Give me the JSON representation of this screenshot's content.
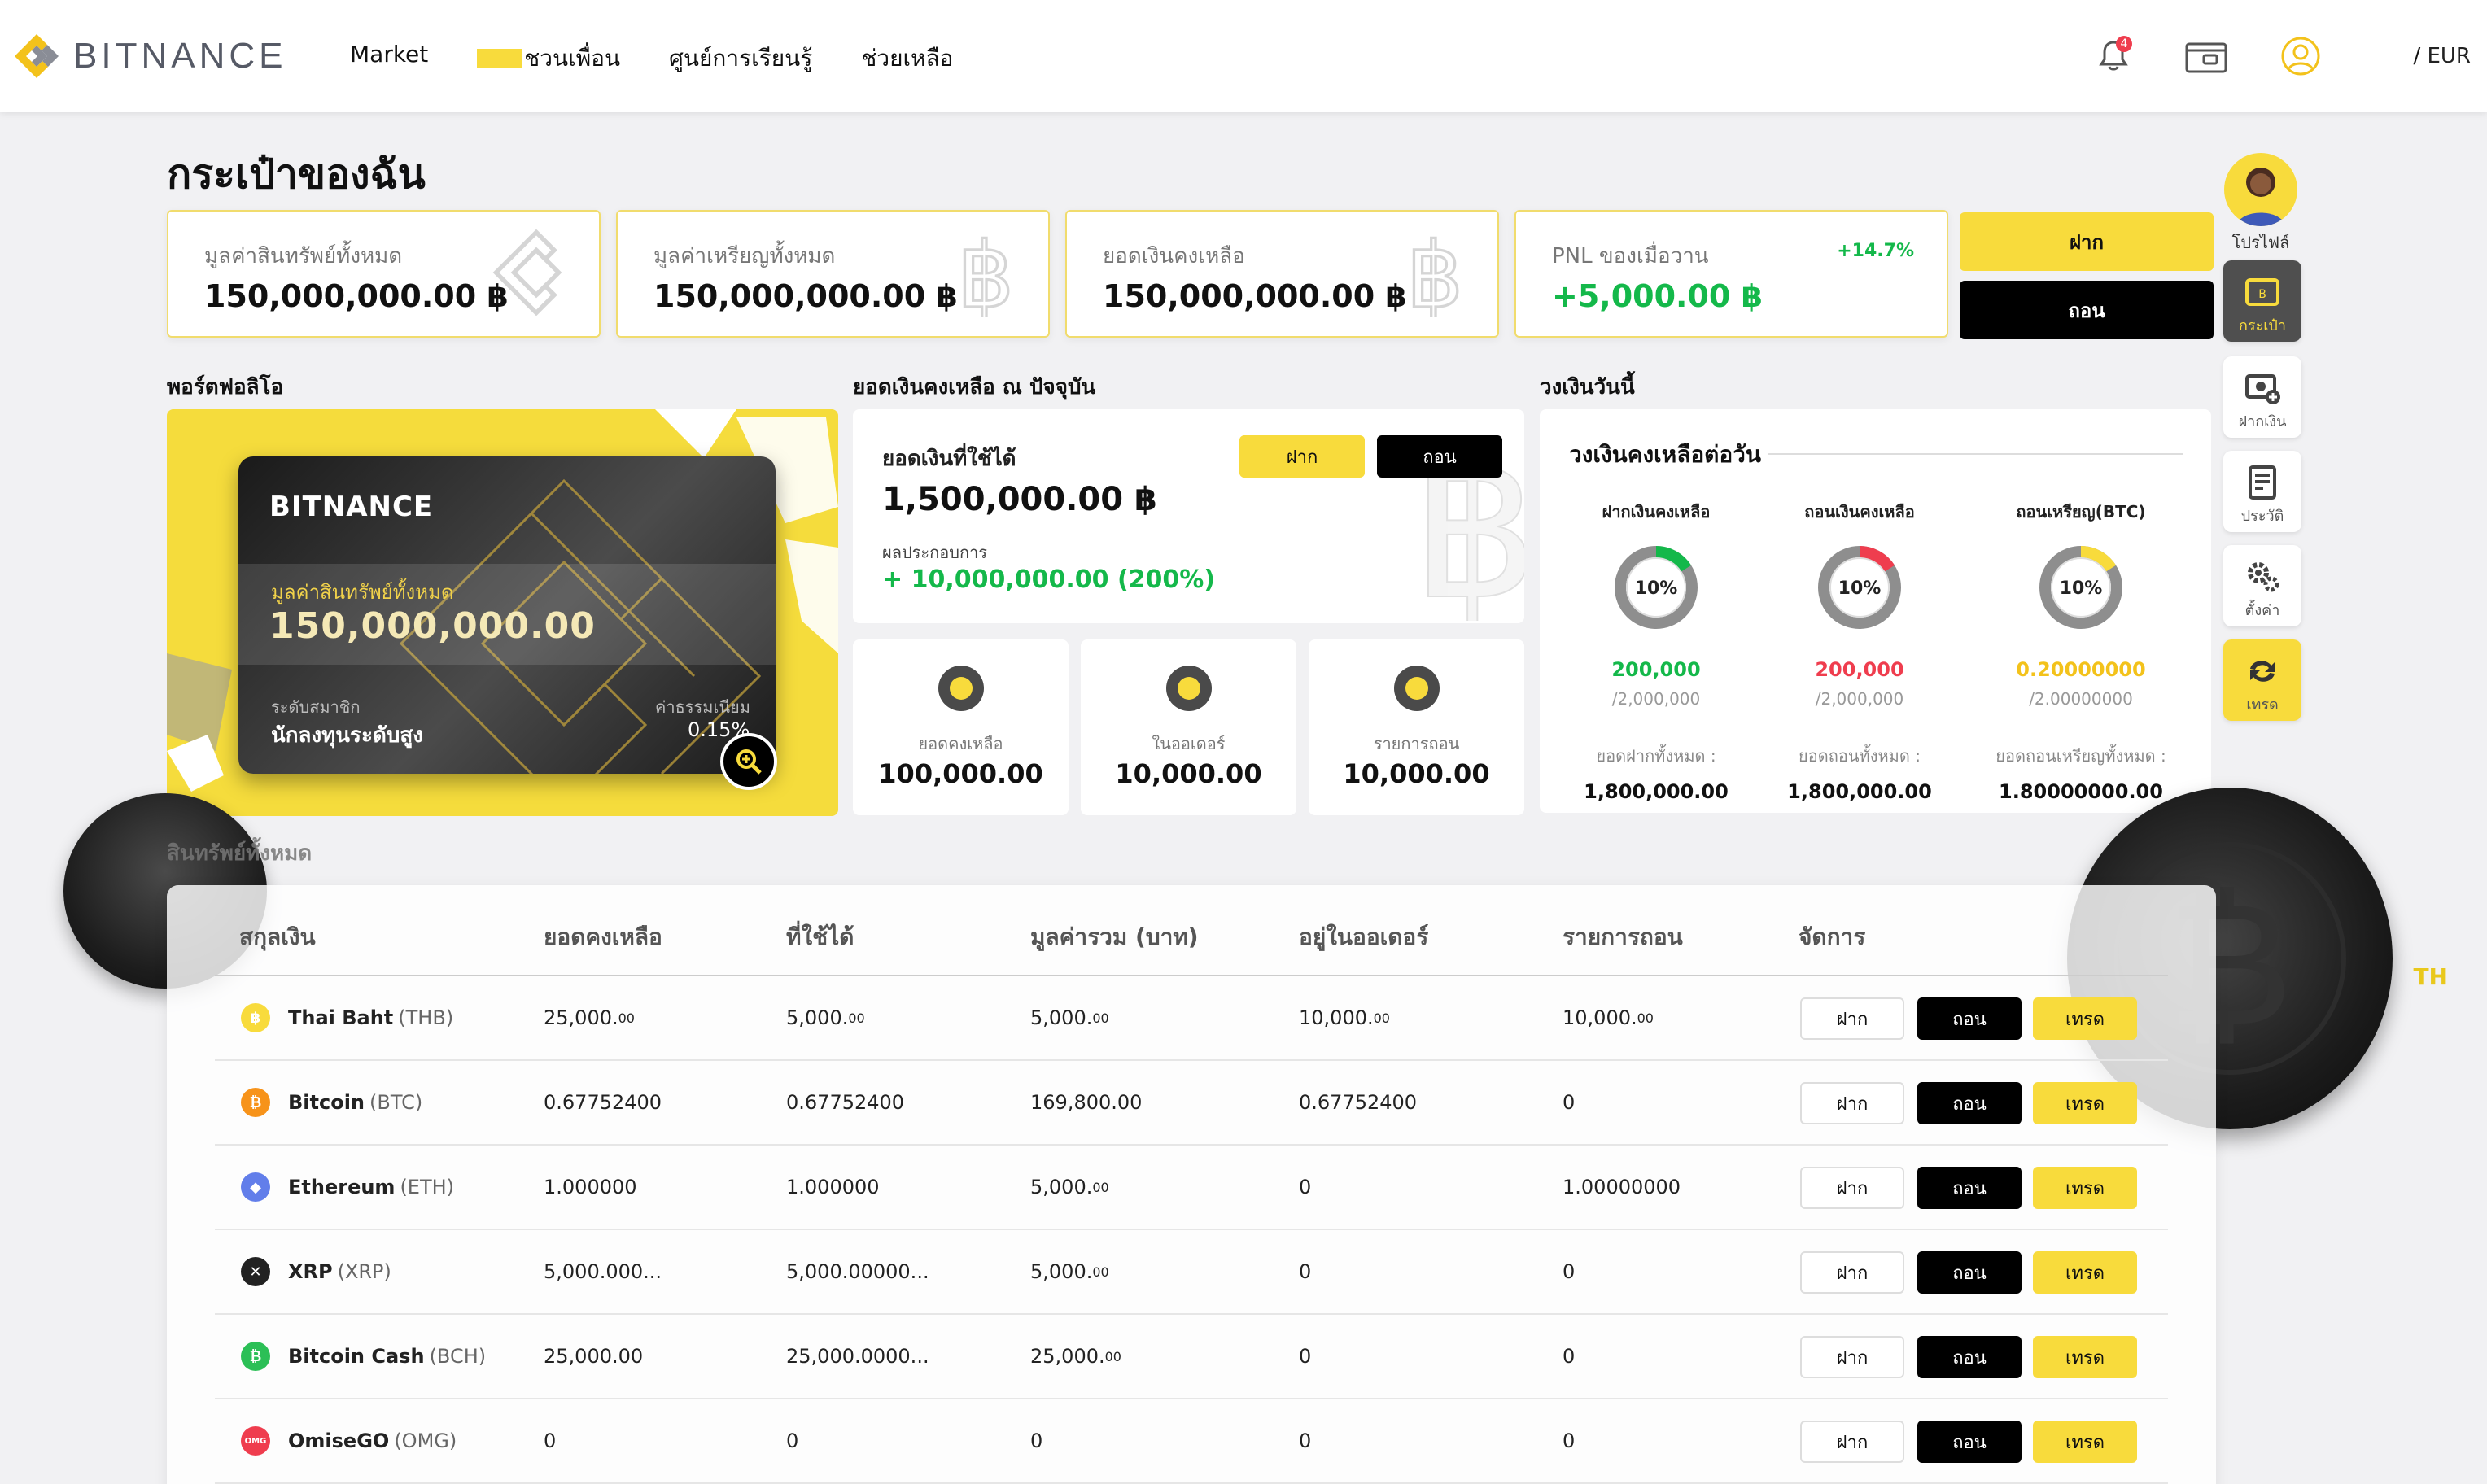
{
  "header": {
    "brand": "BITNANCE",
    "nav": {
      "market": "Market",
      "invite": "ชวนเพื่อน",
      "learn": "ศูนย์การเรียนรู้",
      "help": "ช่วยเหลือ"
    },
    "notification_count": "4",
    "lang": {
      "th": "TH",
      "sep": " / ",
      "currency": "EUR"
    }
  },
  "page_title": "กระเป๋าของฉัน",
  "summary_cards": [
    {
      "label": "มูลค่าสินทรัพย์ทั้งหมด",
      "value": "150,000,000.00 ฿"
    },
    {
      "label": "มูลค่าเหรียญทั้งหมด",
      "value": "150,000,000.00 ฿"
    },
    {
      "label": "ยอดเงินคงเหลือ",
      "value": "150,000,000.00 ฿"
    },
    {
      "label": "PNL ของเมื่อวาน",
      "value": "+5,000.00 ฿",
      "pct": "+14.7%"
    }
  ],
  "top_buttons": {
    "deposit": "ฝาก",
    "withdraw": "ถอน"
  },
  "sections": {
    "portfolio": "พอร์ตฟอลิโอ",
    "balance": "ยอดเงินคงเหลือ ณ ปัจจุบัน",
    "daily": "วงเงินวันนี้",
    "assets": "สินทรัพย์ทั้งหมด"
  },
  "portfolio_card": {
    "brand": "BITNANCE",
    "label": "มูลค่าสินทรัพย์ทั้งหมด",
    "value": "150,000,000.00",
    "member_label": "ระดับสมาชิก",
    "member_value": "นักลงทุนระดับสูง",
    "fee_label": "ค่าธรรมเนียม",
    "fee_value": "0.15%"
  },
  "balance_box": {
    "label": "ยอดเงินที่ใช้ได้",
    "value": "1,500,000.00 ฿",
    "deposit": "ฝาก",
    "withdraw": "ถอน",
    "perf_label": "ผลประกอบการ",
    "perf_value": "+ 10,000,000.00 (200%)"
  },
  "mini_stats": [
    {
      "label": "ยอดคงเหลือ",
      "value": "100,000.00"
    },
    {
      "label": "ในออเดอร์",
      "value": "10,000.00"
    },
    {
      "label": "รายการถอน",
      "value": "10,000.00"
    }
  ],
  "daily": {
    "title": "วงเงินคงเหลือต่อวัน",
    "columns": [
      {
        "title": "ฝากเงินคงเหลือ",
        "pct": "10%",
        "percent_value": 10,
        "value": "200,000",
        "limit": "/2,000,000",
        "total_label": "ยอดฝากทั้งหมด :",
        "total": "1,800,000.00",
        "color": "#14b84a"
      },
      {
        "title": "ถอนเงินคงเหลือ",
        "pct": "10%",
        "percent_value": 10,
        "value": "200,000",
        "limit": "/2,000,000",
        "total_label": "ยอดถอนทั้งหมด :",
        "total": "1,800,000.00",
        "color": "#ef3d4e"
      },
      {
        "title": "ถอนเหรียญ(BTC)",
        "pct": "10%",
        "percent_value": 10,
        "value": "0.20000000",
        "limit": "/2.00000000",
        "total_label": "ยอดถอนเหรียญทั้งหมด :",
        "total": "1.80000000.00",
        "color": "#f8db3c"
      }
    ]
  },
  "sidebar": {
    "profile": "โปรไฟล์",
    "wallet": "กระเป๋า",
    "deposit": "ฝากเงิน",
    "history": "ประวัติ",
    "settings": "ตั้งค่า",
    "trade": "เทรด"
  },
  "table": {
    "headers": [
      "สกุลเงิน",
      "ยอดคงเหลือ",
      "ที่ใช้ได้",
      "มูลค่ารวม (บาท)",
      "อยู่ในออเดอร์",
      "รายการถอน",
      "จัดการ"
    ],
    "actions": {
      "deposit": "ฝาก",
      "withdraw": "ถอน",
      "trade": "เทรด"
    },
    "rows": [
      {
        "name": "Thai Baht",
        "symbol": "(THB)",
        "icon": "฿",
        "color": "#f8db3c",
        "balance": "25,000.",
        "balance_dec": "00",
        "available": "5,000.",
        "available_dec": "00",
        "total": "5,000.",
        "total_dec": "00",
        "order": "10,000.",
        "order_dec": "00",
        "withdraw": "10,000.",
        "withdraw_dec": "00"
      },
      {
        "name": "Bitcoin",
        "symbol": "(BTC)",
        "icon": "₿",
        "color": "#f7931a",
        "balance": "0.67752400",
        "balance_dec": "",
        "available": "0.67752400",
        "available_dec": "",
        "total": "169,800.00",
        "total_dec": "",
        "order": "0.67752400",
        "order_dec": "",
        "withdraw": "0",
        "withdraw_dec": ""
      },
      {
        "name": "Ethereum",
        "symbol": "(ETH)",
        "icon": "◆",
        "color": "#627eea",
        "balance": "1.000000",
        "balance_dec": "",
        "available": "1.000000",
        "available_dec": "",
        "total": "5,000.",
        "total_dec": "00",
        "order": "0",
        "order_dec": "",
        "withdraw": "1.00000000",
        "withdraw_dec": ""
      },
      {
        "name": "XRP",
        "symbol": "(XRP)",
        "icon": "✕",
        "color": "#222222",
        "balance": "5,000.000...",
        "balance_dec": "",
        "available": "5,000.00000...",
        "available_dec": "",
        "total": "5,000.",
        "total_dec": "00",
        "order": "0",
        "order_dec": "",
        "withdraw": "0",
        "withdraw_dec": ""
      },
      {
        "name": "Bitcoin Cash",
        "symbol": "(BCH)",
        "icon": "₿",
        "color": "#2bbf56",
        "balance": "25,000.00",
        "balance_dec": "",
        "available": "25,000.0000...",
        "available_dec": "",
        "total": "25,000.",
        "total_dec": "00",
        "order": "0",
        "order_dec": "",
        "withdraw": "0",
        "withdraw_dec": ""
      },
      {
        "name": "OmiseGO",
        "symbol": "(OMG)",
        "icon": "OMG",
        "color": "#ef3d4e",
        "balance": "0",
        "balance_dec": "",
        "available": "0",
        "available_dec": "",
        "total": "0",
        "total_dec": "",
        "order": "0",
        "order_dec": "",
        "withdraw": "0",
        "withdraw_dec": ""
      }
    ]
  }
}
